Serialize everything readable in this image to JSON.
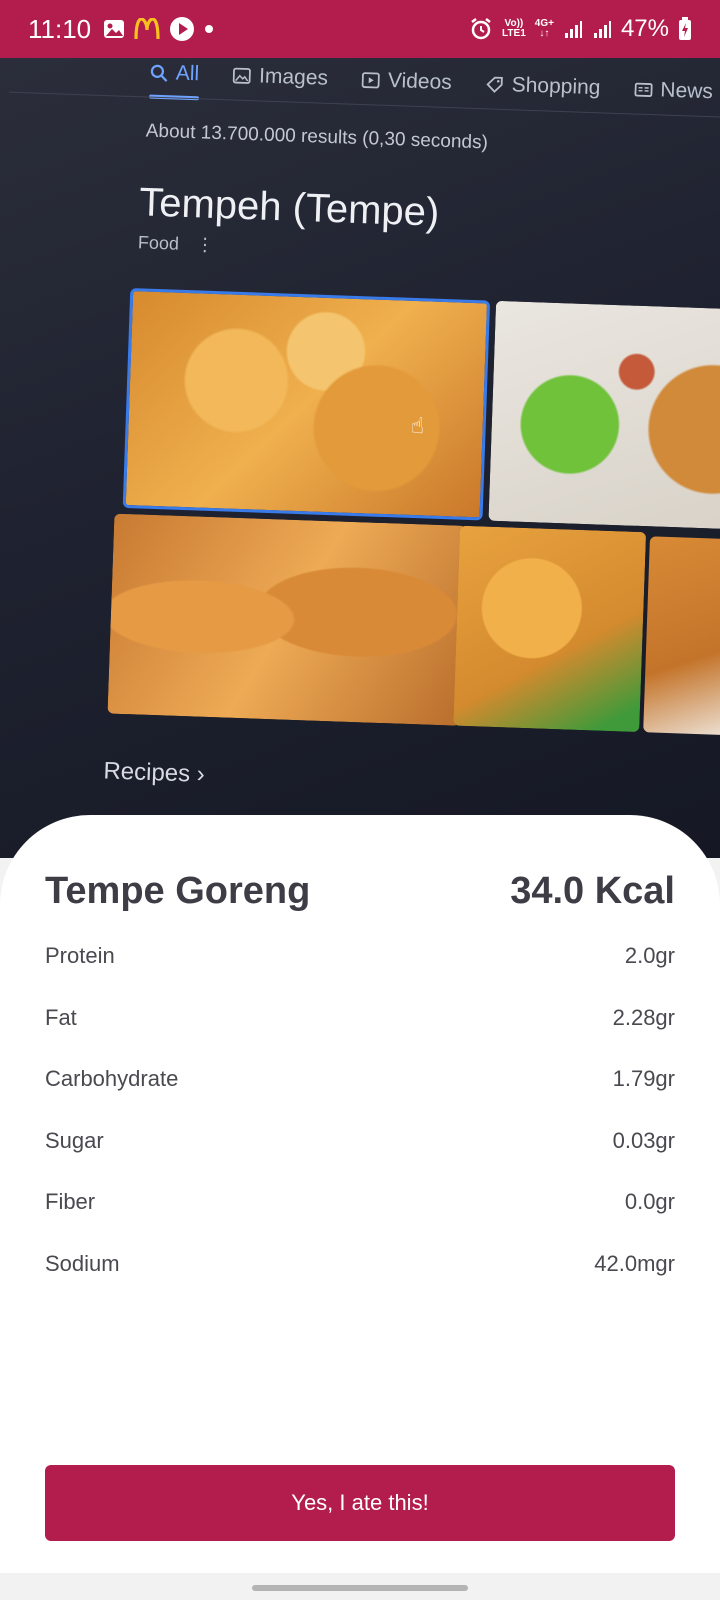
{
  "status_bar": {
    "time": "11:10",
    "left_icons": [
      "image-icon",
      "mcdonalds-icon",
      "play-icon",
      "dot-icon"
    ],
    "volte_top": "Vo))",
    "volte_bottom": "LTE1",
    "network_type": "4G+",
    "battery_percent": "47%",
    "background_color": "#b31d4e"
  },
  "camera_view": {
    "search_tabs": [
      {
        "label": "All",
        "icon": "search-icon",
        "active": true
      },
      {
        "label": "Images",
        "icon": "image-icon"
      },
      {
        "label": "Videos",
        "icon": "video-icon"
      },
      {
        "label": "Shopping",
        "icon": "tag-icon"
      },
      {
        "label": "News",
        "icon": "news-icon"
      }
    ],
    "results_count": "About 13.700.000 results (0,30 seconds)",
    "knowledge_title": "Tempeh (Tempe)",
    "knowledge_subtitle": "Food",
    "recipes_label": "Recipes  ›"
  },
  "food": {
    "name": "Tempe Goreng",
    "calories": "34.0 Kcal",
    "nutrients": [
      {
        "label": "Protein",
        "value": "2.0gr"
      },
      {
        "label": "Fat",
        "value": "2.28gr"
      },
      {
        "label": "Carbohydrate",
        "value": "1.79gr"
      },
      {
        "label": "Sugar",
        "value": "0.03gr"
      },
      {
        "label": "Fiber",
        "value": "0.0gr"
      },
      {
        "label": "Sodium",
        "value": "42.0mgr"
      }
    ]
  },
  "actions": {
    "confirm_label": "Yes, I ate this!"
  },
  "colors": {
    "accent": "#b31d4e",
    "text_primary": "#3e3d46"
  }
}
